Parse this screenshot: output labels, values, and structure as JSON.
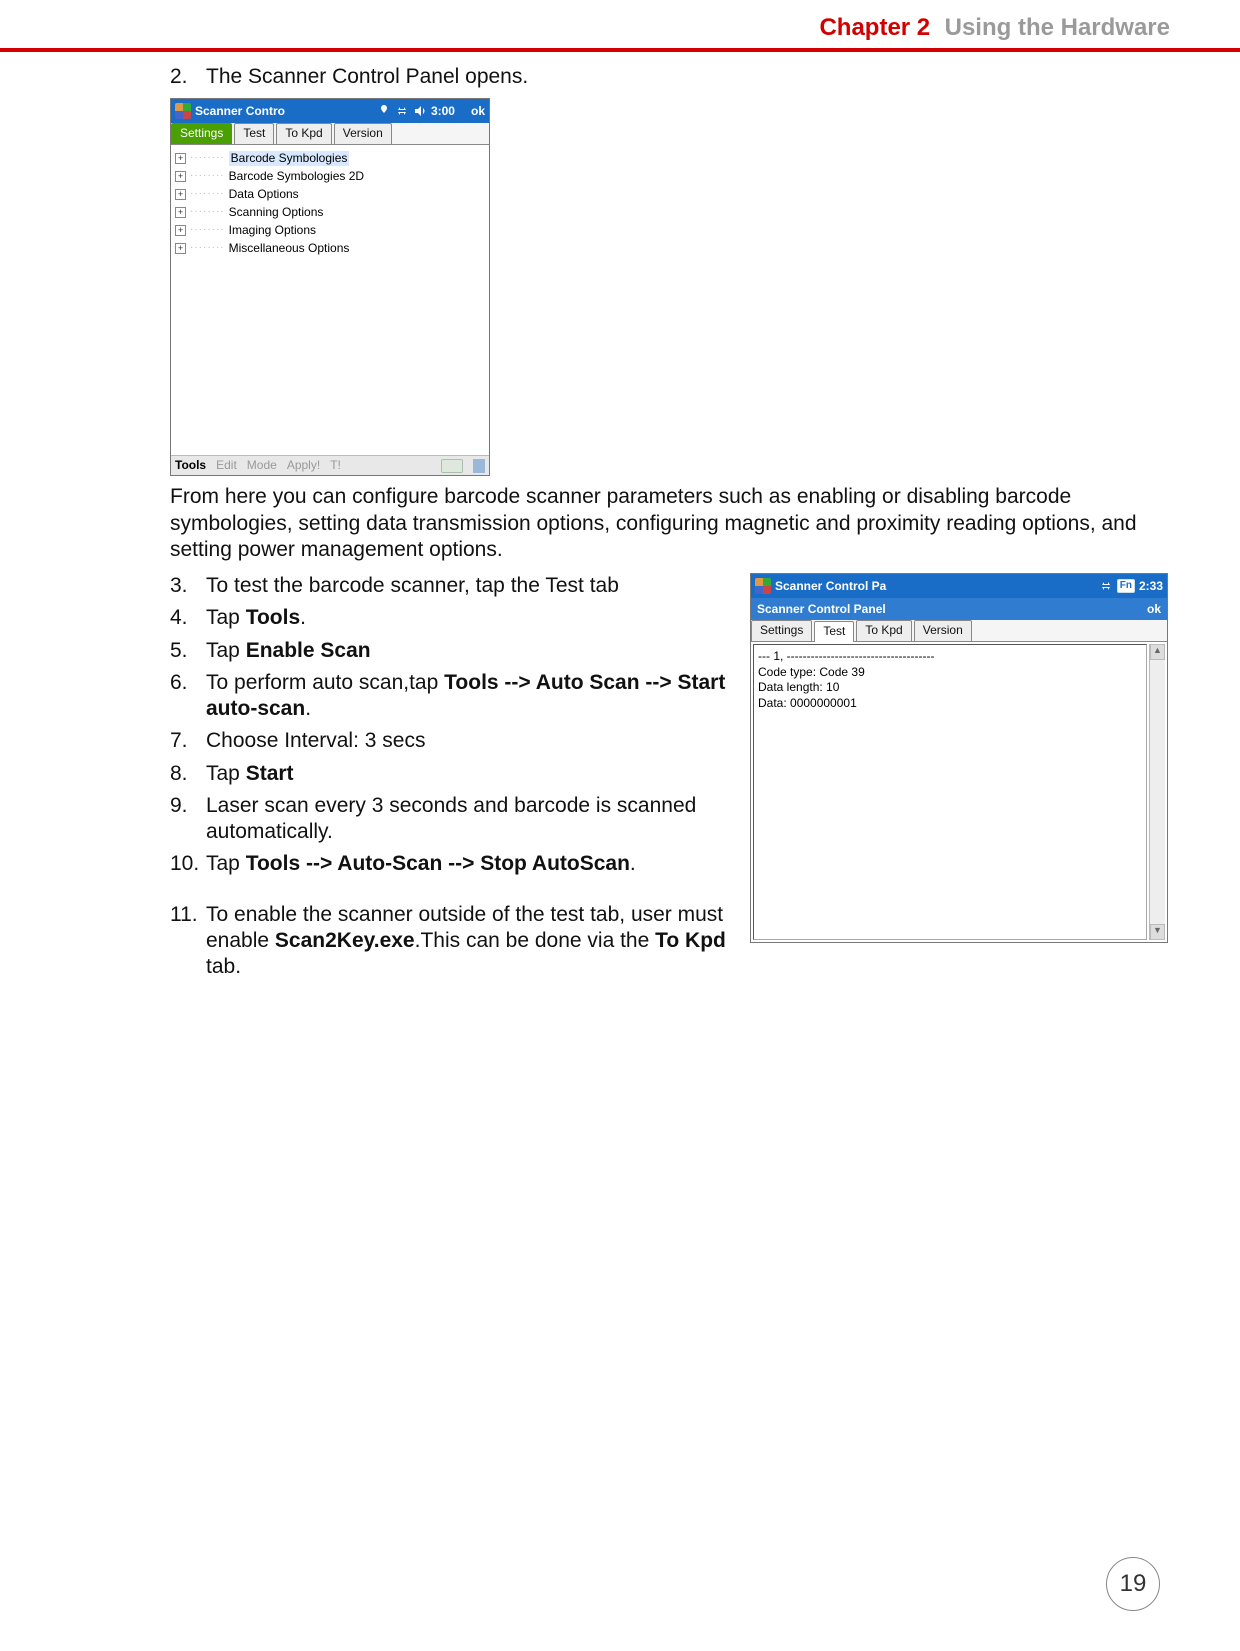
{
  "header": {
    "chapter": "Chapter 2",
    "title": "Using the Hardware"
  },
  "steps_part1": [
    {
      "n": "2.",
      "text": "The Scanner Control Panel opens."
    }
  ],
  "screenshot1": {
    "titlebar_text": "Scanner Contro",
    "time": "3:00",
    "ok": "ok",
    "tabs": [
      "Settings",
      "Test",
      "To Kpd",
      "Version"
    ],
    "tree": [
      "Barcode Symbologies",
      "Barcode Symbologies 2D",
      "Data Options",
      "Scanning Options",
      "Imaging Options",
      "Miscellaneous Options"
    ],
    "menubar": [
      "Tools",
      "Edit",
      "Mode",
      "Apply!",
      "T!"
    ]
  },
  "para_after_ss1": "From here you can configure barcode scanner parameters such as enabling or disabling barcode symbologies, setting data transmission options, configuring magnetic and proximity reading options, and setting power management options.",
  "steps_part2": [
    {
      "n": "3.",
      "segments": [
        {
          "t": "To test the barcode scanner, tap the Test tab"
        }
      ]
    },
    {
      "n": "4.",
      "segments": [
        {
          "t": "Tap "
        },
        {
          "t": "Tools",
          "b": true
        },
        {
          "t": "."
        }
      ]
    },
    {
      "n": "5.",
      "segments": [
        {
          "t": "Tap "
        },
        {
          "t": "Enable Scan",
          "b": true
        }
      ]
    },
    {
      "n": "6.",
      "segments": [
        {
          "t": "To perform auto scan,tap "
        },
        {
          "t": "Tools --> Auto Scan --> Start auto-scan",
          "b": true
        },
        {
          "t": "."
        }
      ]
    },
    {
      "n": "7.",
      "segments": [
        {
          "t": "Choose Interval: 3 secs"
        }
      ]
    },
    {
      "n": "8.",
      "segments": [
        {
          "t": "Tap "
        },
        {
          "t": "Start",
          "b": true
        }
      ]
    },
    {
      "n": "9.",
      "segments": [
        {
          "t": "Laser scan every 3 seconds and barcode is scanned automatically."
        }
      ]
    },
    {
      "n": "10.",
      "segments": [
        {
          "t": "Tap "
        },
        {
          "t": "Tools --> Auto-Scan --> Stop AutoScan",
          "b": true
        },
        {
          "t": "."
        }
      ]
    },
    {
      "n": "11.",
      "segments": [
        {
          "t": "To enable the scanner outside of the test tab, user must enable "
        },
        {
          "t": "Scan2Key.exe",
          "b": true
        },
        {
          "t": ".This can be done via the "
        },
        {
          "t": "To Kpd",
          "b": true
        },
        {
          "t": " tab."
        }
      ]
    }
  ],
  "screenshot2": {
    "titlebar_text": "Scanner Control Pa",
    "fn": "Fn",
    "time": "2:33",
    "subtitle": "Scanner Control Panel",
    "ok": "ok",
    "tabs": [
      "Settings",
      "Test",
      "To Kpd",
      "Version"
    ],
    "lines": [
      "--- 1, -------------------------------------",
      "Code type: Code 39",
      "Data length: 10",
      "Data: 0000000001"
    ]
  },
  "page_number": "19"
}
